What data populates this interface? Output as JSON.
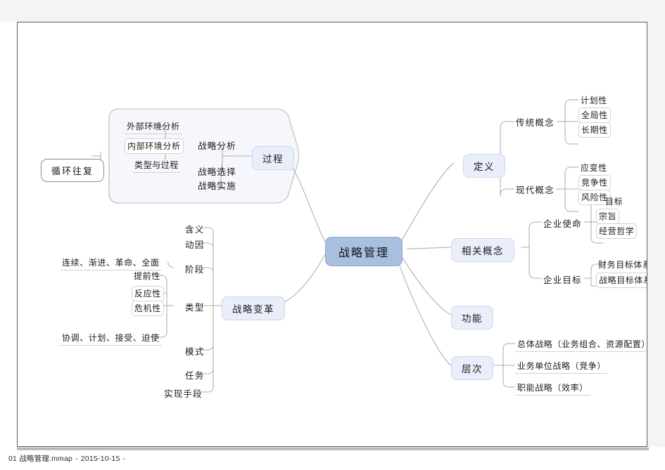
{
  "app": {
    "document_name": "01 战略管理.mmap",
    "date": "2015-10-15",
    "trailing_sep": "-",
    "sep": "-"
  },
  "colors": {
    "root_fill": "#a8bfe0",
    "root_stroke": "#8fa9d0",
    "branch_fill": "#e9eefa",
    "branch_stroke": "#cbd8ef",
    "line": "#b0b0b0",
    "leaf_underline": "#d2d2d2",
    "callout_stroke": "#8a8a8a",
    "boundary_fill": "#f5f7fc",
    "boundary_stroke": "#b9b9b9",
    "canvas": "#ffffff",
    "page_bg": "#f4f4f4"
  },
  "map": {
    "root": "战略管理",
    "callout": "循环往复",
    "branches": {
      "guocheng": {
        "label": "过程",
        "children": {
          "zhanlue_fenxi": {
            "label": "战略分析",
            "leaves": [
              "外部环境分析",
              "内部环境分析",
              "类型与过程"
            ]
          },
          "zhanlue_xuanze": {
            "label": "战略选择"
          },
          "zhanlue_shishi": {
            "label": "战略实施"
          }
        }
      },
      "dingyi": {
        "label": "定义",
        "children": {
          "chuantong": {
            "label": "传统概念",
            "leaves": [
              "计划性",
              "全局性",
              "长期性"
            ]
          },
          "xiandai": {
            "label": "现代概念",
            "leaves": [
              "应变性",
              "竞争性",
              "风险性"
            ]
          }
        }
      },
      "xiangguan": {
        "label": "相关概念",
        "children": {
          "qiye_shiming": {
            "label": "企业使命",
            "leaves": [
              "目标",
              "宗旨",
              "经营哲学"
            ]
          },
          "qiye_mubiao": {
            "label": "企业目标",
            "leaves": [
              "财务目标体系",
              "战略目标体系"
            ]
          }
        }
      },
      "gongneng": {
        "label": "功能"
      },
      "cengci": {
        "label": "层次",
        "leaves": [
          "总体战略（业务组合、资源配置）",
          "业务单位战略（竞争）",
          "职能战略（效率）"
        ]
      },
      "biange": {
        "label": "战略变革",
        "children": {
          "hanyi": {
            "label": "含义"
          },
          "dongyin": {
            "label": "动因"
          },
          "jieduan": {
            "label": "阶段",
            "leaves": [
              "连续、渐进、革命、全面"
            ]
          },
          "leixing": {
            "label": "类型",
            "leaves": [
              "提前性",
              "反应性",
              "危机性",
              "协调、计划、接受、迫使"
            ]
          },
          "moshi": {
            "label": "模式"
          },
          "renwu": {
            "label": "任务"
          },
          "shixian": {
            "label": "实现手段"
          }
        }
      }
    }
  }
}
